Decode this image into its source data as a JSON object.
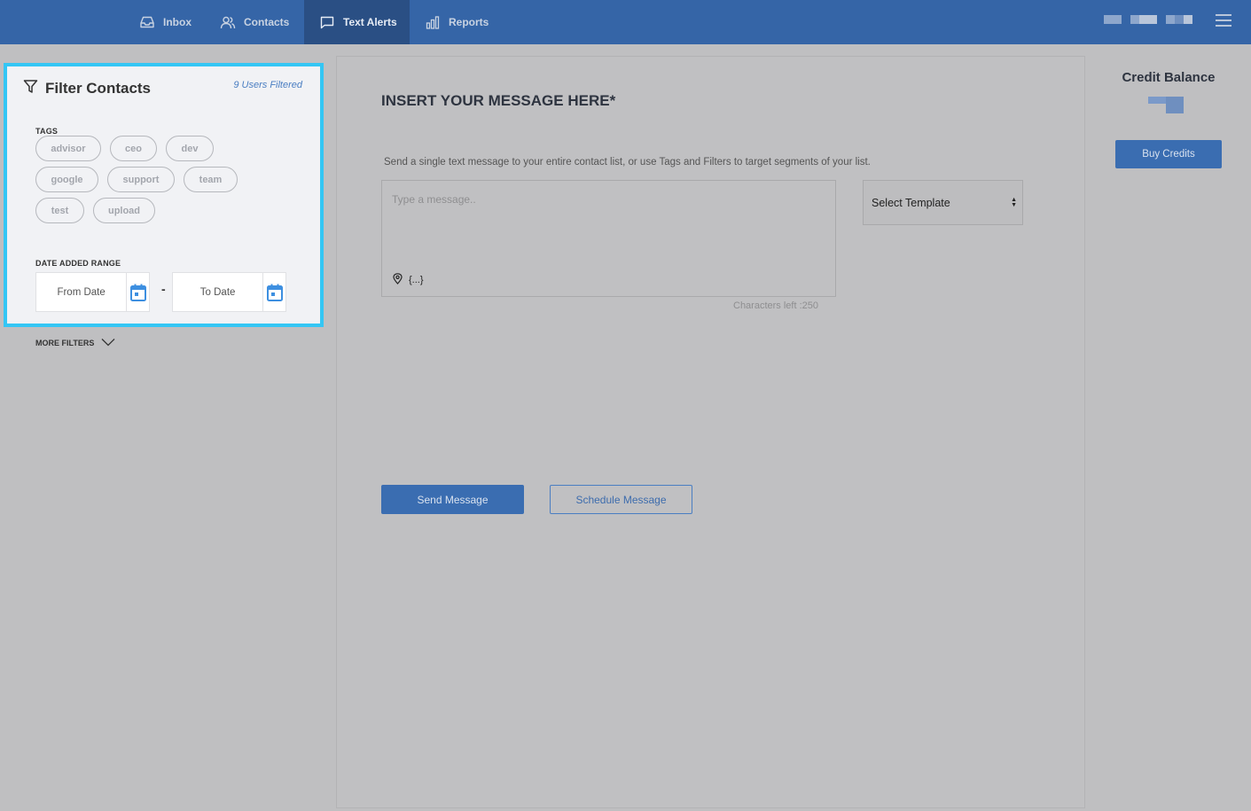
{
  "nav": {
    "items": [
      {
        "label": "Inbox",
        "icon": "inbox-icon"
      },
      {
        "label": "Contacts",
        "icon": "users-icon"
      },
      {
        "label": "Text Alerts",
        "icon": "chat-icon",
        "active": true
      },
      {
        "label": "Reports",
        "icon": "bar-chart-icon"
      }
    ]
  },
  "filter": {
    "title": "Filter Contacts",
    "users_filtered": "9 Users Filtered",
    "tags_label": "TAGS",
    "tags": [
      "advisor",
      "ceo",
      "dev",
      "google",
      "support",
      "team",
      "test",
      "upload"
    ],
    "date_label": "DATE ADDED RANGE",
    "from_date": "From Date",
    "to_date": "To Date",
    "date_separator": "-",
    "more_filters": "MORE FILTERS"
  },
  "main": {
    "title": "INSERT YOUR MESSAGE HERE*",
    "description": "Send a single text message to your entire contact list, or use Tags and Filters to target segments of your list.",
    "message_placeholder": "Type a message..",
    "variables_token": "{...}",
    "chars_left": "Characters left :250",
    "template_select": "Select Template",
    "send_label": "Send Message",
    "schedule_label": "Schedule Message"
  },
  "credit": {
    "title": "Credit Balance",
    "buy_label": "Buy Credits"
  },
  "colors": {
    "nav_bg": "#3565a7",
    "nav_active": "#2a4f84",
    "highlight_border": "#34c6f4",
    "primary": "#3a6db1",
    "link": "#4a7ec2",
    "calendar": "#3d8fe0"
  }
}
